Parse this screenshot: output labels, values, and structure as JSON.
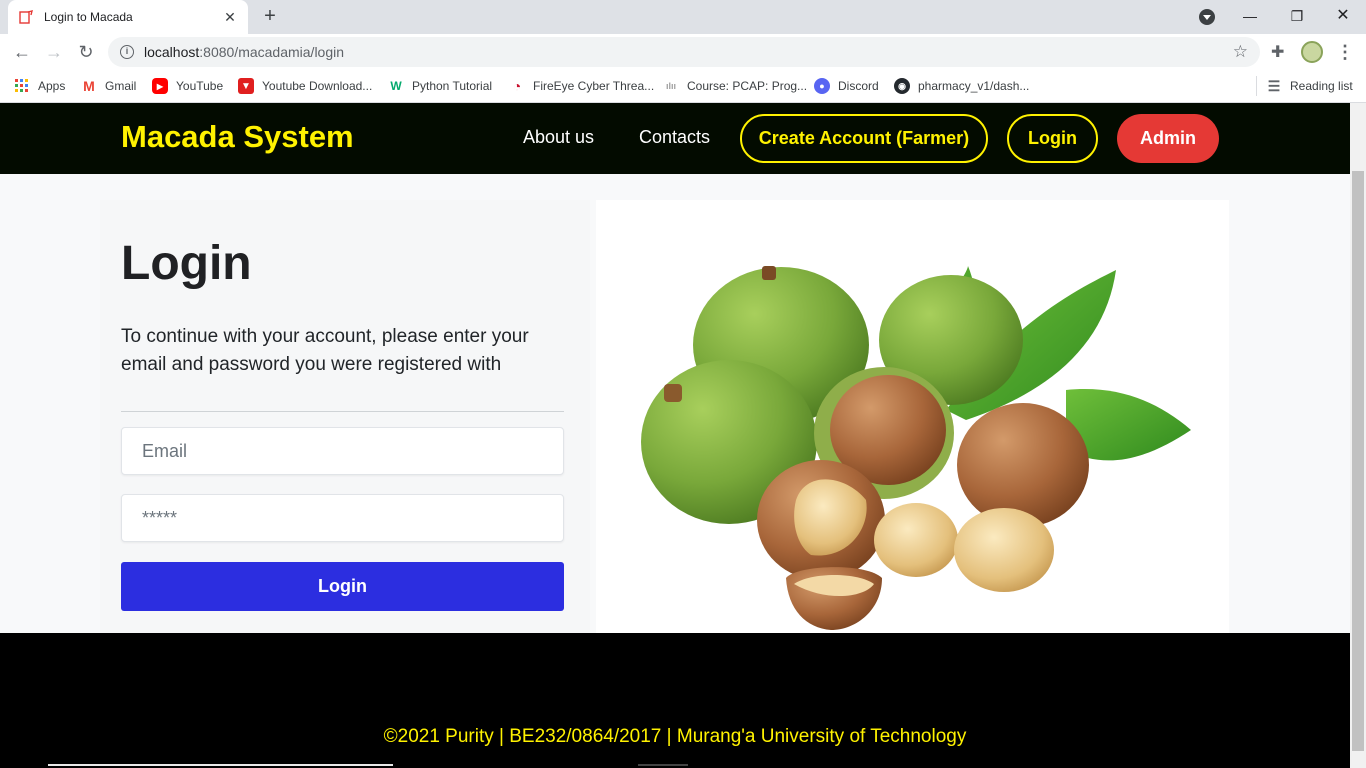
{
  "browser": {
    "tab_title": "Login to Macada",
    "url_host": "localhost",
    "url_path": ":8080/macadamia/login",
    "bookmarks": [
      {
        "label": "Apps",
        "icon": "apps-grid-icon",
        "color": "#4285f4"
      },
      {
        "label": "Gmail",
        "icon": "gmail-icon",
        "color": "#ea4335"
      },
      {
        "label": "YouTube",
        "icon": "youtube-icon",
        "color": "#ff0000"
      },
      {
        "label": "Youtube Download...",
        "icon": "download-icon",
        "color": "#e01f1f"
      },
      {
        "label": "Python Tutorial",
        "icon": "w3schools-icon",
        "color": "#04aa6d"
      },
      {
        "label": "FireEye Cyber Threa...",
        "icon": "fireeye-icon",
        "color": "#c8102e"
      },
      {
        "label": "Course: PCAP: Prog...",
        "icon": "cisco-icon",
        "color": "#9e9e9e"
      },
      {
        "label": "Discord",
        "icon": "discord-icon",
        "color": "#5865f2"
      },
      {
        "label": "pharmacy_v1/dash...",
        "icon": "github-icon",
        "color": "#24292e"
      }
    ],
    "reading_list": "Reading list"
  },
  "header": {
    "brand": "Macada System",
    "nav": {
      "about": "About us",
      "contacts": "Contacts",
      "create_account": "Create Account (Farmer)",
      "login": "Login",
      "admin": "Admin"
    },
    "colors": {
      "brand": "#fff200",
      "admin": "#e53935",
      "background": "#030b00"
    }
  },
  "login": {
    "title": "Login",
    "description": "To continue with your account, please enter your email and password you were registered with",
    "email_placeholder": "Email",
    "password_placeholder": "*****",
    "button_label": "Login",
    "button_color": "#2c2ee0"
  },
  "footer": {
    "copyright": "©2021 Purity | BE232/0864/2017 | Murang'a University of Technology"
  }
}
